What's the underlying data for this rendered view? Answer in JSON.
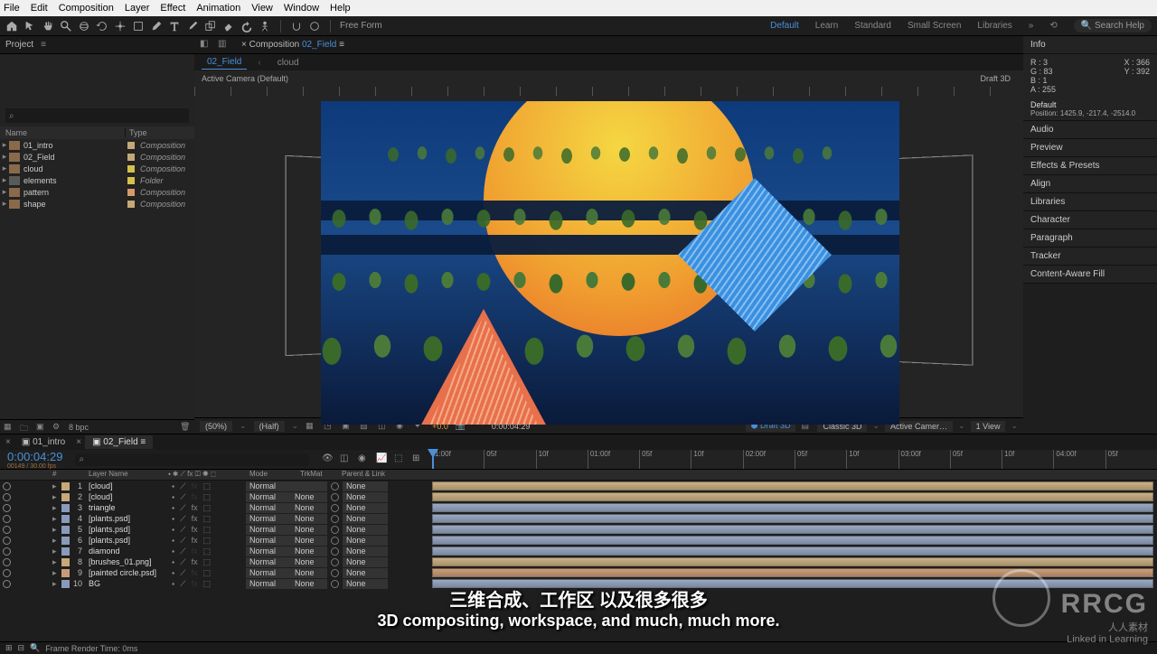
{
  "menu": [
    "File",
    "Edit",
    "Composition",
    "Layer",
    "Effect",
    "Animation",
    "View",
    "Window",
    "Help"
  ],
  "toolbar": {
    "mode_label": "Free Form",
    "workspaces": [
      "Default",
      "Learn",
      "Standard",
      "Small Screen",
      "Libraries"
    ],
    "active_workspace": "Default",
    "search_placeholder": "Search Help"
  },
  "project": {
    "tab": "Project",
    "search_icon": "search-icon",
    "name_col": "Name",
    "type_col": "Type",
    "items": [
      {
        "name": "01_intro",
        "type": "Composition",
        "swatch": "sw-tan",
        "icon": "ic-comp"
      },
      {
        "name": "02_Field",
        "type": "Composition",
        "swatch": "sw-tan",
        "icon": "ic-comp"
      },
      {
        "name": "cloud",
        "type": "Composition",
        "swatch": "sw-yellow",
        "icon": "ic-comp"
      },
      {
        "name": "elements",
        "type": "Folder",
        "swatch": "sw-yellow",
        "icon": "ic-folder"
      },
      {
        "name": "pattern",
        "type": "Composition",
        "swatch": "sw-peach",
        "icon": "ic-comp"
      },
      {
        "name": "shape",
        "type": "Composition",
        "swatch": "sw-tan",
        "icon": "ic-comp"
      }
    ],
    "footer_bpc": "8 bpc"
  },
  "comp": {
    "tab_prefix": "Composition",
    "tab_name": "02_Field",
    "breadcrumb": [
      "02_Field",
      "cloud"
    ],
    "active_camera": "Active Camera (Default)",
    "draft3d": "Draft 3D"
  },
  "viewer_footer": {
    "zoom": "(50%)",
    "res": "(Half)",
    "exposure": "+0.0",
    "time": "0:00:04:29",
    "draft3d": "Draft 3D",
    "renderer": "Classic 3D",
    "camera": "Active Camer…",
    "view": "1 View"
  },
  "right": {
    "info": {
      "title": "Info",
      "r": "R : 3",
      "g": "G : 83",
      "b": "B : 1",
      "a": "A : 255",
      "x": "X : 366",
      "y": "Y : 392"
    },
    "default": {
      "label": "Default",
      "pos": "Position: 1425.9, -217.4, -2514.0"
    },
    "panels": [
      "Audio",
      "Preview",
      "Effects & Presets",
      "Align",
      "Libraries",
      "Character",
      "Paragraph",
      "Tracker",
      "Content-Aware Fill"
    ]
  },
  "timeline": {
    "tabs": [
      "01_intro",
      "02_Field"
    ],
    "active_tab": "02_Field",
    "timecode": "0:00:04:29",
    "subframe": "00149 / 30.00 fps",
    "head": {
      "name": "Layer Name",
      "mode": "Mode",
      "trkmat": "TrkMat",
      "parent": "Parent & Link"
    },
    "ruler": [
      "1:00f",
      "05f",
      "10f",
      "01:00f",
      "05f",
      "10f",
      "02:00f",
      "05f",
      "10f",
      "03:00f",
      "05f",
      "10f",
      "04:00f",
      "05f"
    ],
    "layers": [
      {
        "n": 1,
        "name": "[cloud]",
        "mode": "Normal",
        "trk": "",
        "parent": "None",
        "c": "c1",
        "b": "b1",
        "fx": false,
        "cube": true
      },
      {
        "n": 2,
        "name": "[cloud]",
        "mode": "Normal",
        "trk": "None",
        "parent": "None",
        "c": "c1",
        "b": "b1",
        "fx": false,
        "cube": true
      },
      {
        "n": 3,
        "name": "triangle",
        "mode": "Normal",
        "trk": "None",
        "parent": "None",
        "c": "c2",
        "b": "b2",
        "fx": true,
        "cube": true
      },
      {
        "n": 4,
        "name": "[plants.psd]",
        "mode": "Normal",
        "trk": "None",
        "parent": "None",
        "c": "c2",
        "b": "b2",
        "fx": true,
        "cube": true
      },
      {
        "n": 5,
        "name": "[plants.psd]",
        "mode": "Normal",
        "trk": "None",
        "parent": "None",
        "c": "c2",
        "b": "b2",
        "fx": true,
        "cube": true
      },
      {
        "n": 6,
        "name": "[plants.psd]",
        "mode": "Normal",
        "trk": "None",
        "parent": "None",
        "c": "c2",
        "b": "b2",
        "fx": true,
        "cube": true
      },
      {
        "n": 7,
        "name": "diamond",
        "mode": "Normal",
        "trk": "None",
        "parent": "None",
        "c": "c2",
        "b": "b2",
        "fx": false,
        "cube": true
      },
      {
        "n": 8,
        "name": "[brushes_01.png]",
        "mode": "Normal",
        "trk": "None",
        "parent": "None",
        "c": "c1",
        "b": "b1",
        "fx": true,
        "cube": true
      },
      {
        "n": 9,
        "name": "[painted circle.psd]",
        "mode": "Normal",
        "trk": "None",
        "parent": "None",
        "c": "c3",
        "b": "b3",
        "fx": false,
        "cube": true
      },
      {
        "n": 10,
        "name": "BG",
        "mode": "Normal",
        "trk": "None",
        "parent": "None",
        "c": "c2",
        "b": "b2",
        "fx": false,
        "cube": true
      }
    ],
    "footer": "Frame Render Time: 0ms"
  },
  "subtitles": {
    "zh": "三维合成、工作区 以及很多很多",
    "en": "3D compositing, workspace, and much, much more."
  },
  "watermark": {
    "logo": "RRCG",
    "sub": "人人素材",
    "li": "Linked in Learning"
  }
}
